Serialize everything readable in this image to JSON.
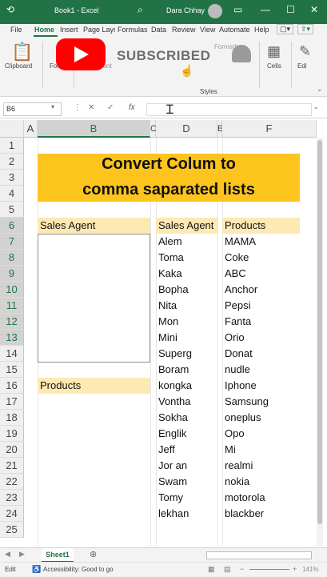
{
  "window": {
    "title": "Book1 - Excel",
    "user": "Dara Chhay"
  },
  "ribbon_tabs": [
    "File",
    "Home",
    "Insert",
    "Page Layout",
    "Formulas",
    "Data",
    "Review",
    "View",
    "Automate",
    "Help"
  ],
  "ribbon": {
    "clipboard": "Clipboard",
    "font": "Font",
    "alignment": "Alignment",
    "formatting": "Formatting",
    "cells": "Cells",
    "editing": "Editing",
    "styles": "Styles"
  },
  "overlay": {
    "subscribed": "SUBSCRIBED"
  },
  "formula_bar": {
    "name_box": "B6",
    "fx": "fx"
  },
  "columns": [
    "A",
    "B",
    "C",
    "D",
    "E",
    "F"
  ],
  "rows": [
    "1",
    "2",
    "3",
    "4",
    "5",
    "6",
    "7",
    "8",
    "9",
    "10",
    "11",
    "12",
    "13",
    "14",
    "15",
    "16",
    "17",
    "18",
    "19",
    "20",
    "21",
    "22",
    "23",
    "24",
    "25"
  ],
  "sheet": {
    "title_line1": "Convert Colum to",
    "title_line2": "comma saparated lists",
    "b5": "Sales Agent",
    "b15": "Products",
    "d5": "Sales Agent",
    "f5": "Products",
    "agents": [
      "Alem",
      "Toma",
      "Kaka",
      "Bopha",
      "Nita",
      "Mon",
      "Mini",
      "Superg",
      "Boram",
      "kongka",
      "Vontha",
      "Sokha",
      "Englik",
      "Jeff",
      "Jor an",
      "Swam",
      "Tomy",
      "lekhan"
    ],
    "products": [
      "MAMA",
      "Coke",
      "ABC",
      "Anchor",
      "Pepsi",
      "Fanta",
      "Orio",
      "Donat",
      "nudle",
      "Iphone",
      "Samsung",
      "oneplus",
      "Opo",
      "Mi",
      "realmi",
      "nokia",
      "motorola",
      "blackber"
    ]
  },
  "sheet_tab": "Sheet1",
  "status": {
    "mode": "Edit",
    "accessibility": "Accessibility: Good to go",
    "zoom": "141%"
  },
  "colors": {
    "excel_green": "#217346",
    "title_fill": "#fcc41c",
    "header_fill": "#fde9b3",
    "yt_red": "#ff0000"
  }
}
